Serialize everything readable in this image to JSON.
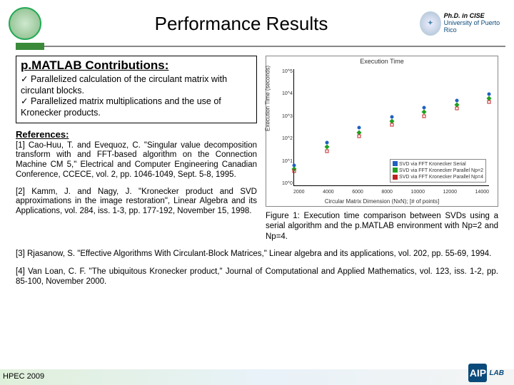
{
  "header": {
    "title": "Performance Results",
    "left_logo_alt": "UPR seal",
    "right_logo_line1": "Ph.D. in CISE",
    "right_logo_line2": "University of Puerto Rico"
  },
  "contrib": {
    "heading": "p.MATLAB  Contributions:",
    "items": [
      "Parallelized calculation of the circulant matrix with circulant blocks.",
      "Parallelized matrix multiplications and the use of Kronecker products."
    ]
  },
  "refs": {
    "heading": "References:",
    "r1": "[1] Cao-Huu, T. and Evequoz, C. \"Singular value decomposition transform with and FFT-based algorithm on the Connection Machine CM 5,\" Electrical and Computer Engineering Canadian Conference, CCECE, vol. 2, pp. 1046-1049, Sept. 5-8, 1995.",
    "r2": "[2] Kamm, J. and Nagy, J. \"Kronecker product and SVD approximations in the image restoration\", Linear Algebra and its Applications, vol. 284, iss. 1-3, pp. 177-192, November 15, 1998.",
    "r3": "[3] Rjasanow, S. \"Effective Algorithms With Circulant-Block Matrices,\" Linear algebra and its applications, vol. 202, pp. 55-69, 1994.",
    "r4": "[4] Van Loan, C. F. \"The ubiquitous Kronecker product,\" Journal of Computational and Applied Mathematics, vol. 123, iss. 1-2, pp. 85-100, November 2000."
  },
  "figure": {
    "caption": "Figure 1: Execution time comparison between SVDs using a serial algorithm and the p.MATLAB environment with Np=2 and Np=4."
  },
  "footer": {
    "conf": "HPEC 2009",
    "lab_short": "AIP",
    "lab_word": "LAB"
  },
  "chart_data": {
    "type": "scatter",
    "title": "Execution Time",
    "xlabel": "Circular Matrix Dimension (NxN); [# of points]",
    "ylabel": "Execution Time (seconds)",
    "yscale": "log",
    "ylim": [
      1,
      100000
    ],
    "x": [
      2000,
      4000,
      6000,
      8000,
      10000,
      12000,
      14000
    ],
    "series": [
      {
        "name": "SVD via FFT Kronecker Serial",
        "marker": "star",
        "color": "#2060c0",
        "values": [
          7,
          70,
          300,
          900,
          2200,
          4500,
          8500
        ]
      },
      {
        "name": "SVD via FFT Kronecker Parallel Np=2",
        "marker": "diamond",
        "color": "#20a020",
        "values": [
          5,
          45,
          190,
          580,
          1400,
          2900,
          5500
        ]
      },
      {
        "name": "SVD via FFT Kronecker Parallel Np=4",
        "marker": "square",
        "color": "#c02020",
        "values": [
          4,
          30,
          130,
          400,
          950,
          2000,
          3800
        ]
      }
    ],
    "yticks": [
      "10^5",
      "10^4",
      "10^3",
      "10^2",
      "10^1",
      "10^0"
    ],
    "xticks": [
      "2000",
      "4000",
      "6000",
      "8000",
      "10000",
      "12000",
      "14000"
    ]
  }
}
